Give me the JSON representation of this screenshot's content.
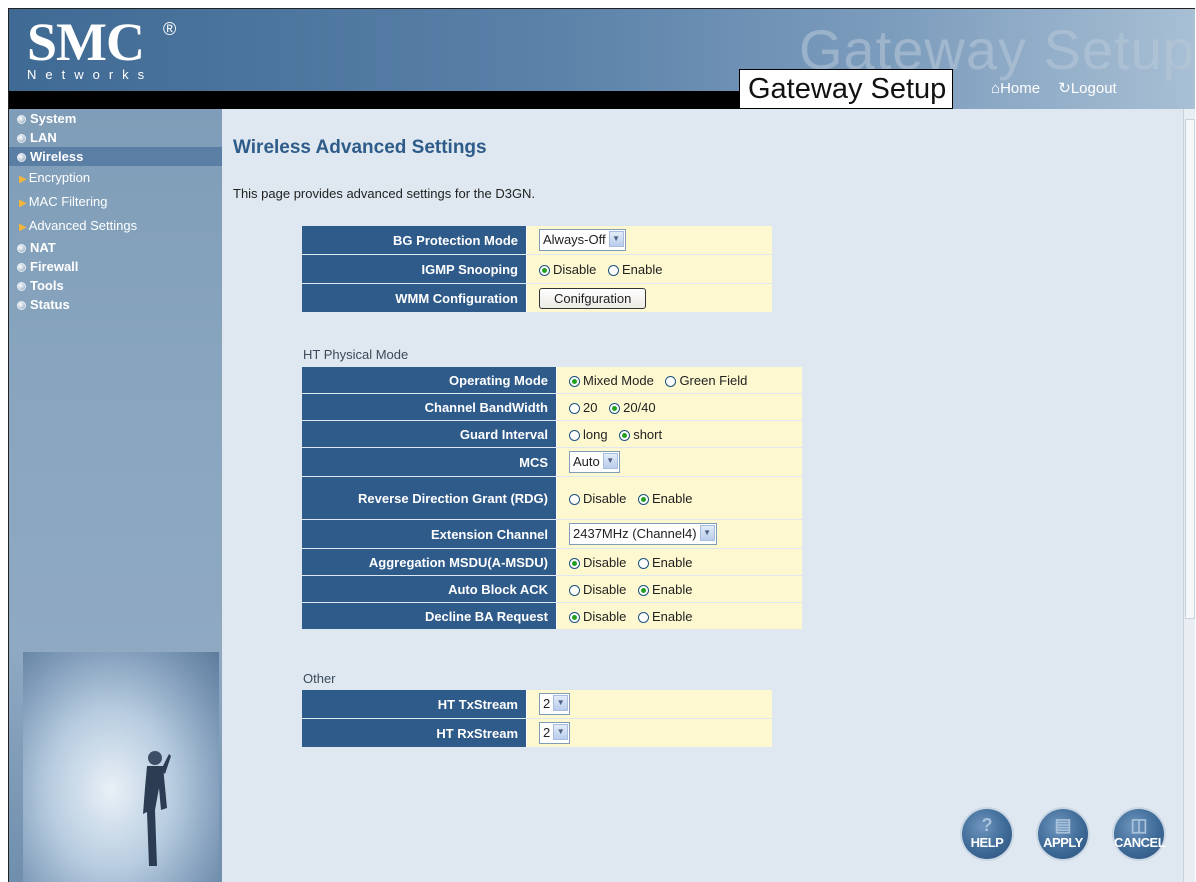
{
  "header": {
    "logo_main": "SMC",
    "logo_reg": "®",
    "logo_sub": "Networks",
    "banner_text": "Gateway Setup",
    "title": "Gateway Setup",
    "home_label": "Home",
    "logout_label": "Logout"
  },
  "sidebar": {
    "items": [
      {
        "label": "System"
      },
      {
        "label": "LAN"
      },
      {
        "label": "Wireless"
      },
      {
        "label": "NAT"
      },
      {
        "label": "Firewall"
      },
      {
        "label": "Tools"
      },
      {
        "label": "Status"
      }
    ],
    "sub_items": [
      {
        "label": "Encryption"
      },
      {
        "label": "MAC Filtering"
      },
      {
        "label": "Advanced Settings"
      }
    ]
  },
  "page": {
    "title": "Wireless Advanced Settings",
    "description": "This page provides advanced settings for the D3GN."
  },
  "basic": {
    "bg_protection": {
      "label": "BG Protection Mode",
      "value": "Always-Off"
    },
    "igmp": {
      "label": "IGMP Snooping",
      "opt1": "Disable",
      "opt2": "Enable",
      "selected": "Disable"
    },
    "wmm": {
      "label": "WMM Configuration",
      "button": "Conifguration"
    }
  },
  "ht": {
    "section_label": "HT Physical Mode",
    "operating_mode": {
      "label": "Operating Mode",
      "opt1": "Mixed Mode",
      "opt2": "Green Field",
      "selected": "Mixed Mode"
    },
    "bandwidth": {
      "label": "Channel BandWidth",
      "opt1": "20",
      "opt2": "20/40",
      "selected": "20/40"
    },
    "guard": {
      "label": "Guard Interval",
      "opt1": "long",
      "opt2": "short",
      "selected": "short"
    },
    "mcs": {
      "label": "MCS",
      "value": "Auto"
    },
    "rdg": {
      "label": "Reverse Direction Grant (RDG)",
      "opt1": "Disable",
      "opt2": "Enable",
      "selected": "Enable"
    },
    "ext_channel": {
      "label": "Extension Channel",
      "value": "2437MHz (Channel4)"
    },
    "amsdu": {
      "label": "Aggregation MSDU(A-MSDU)",
      "opt1": "Disable",
      "opt2": "Enable",
      "selected": "Disable"
    },
    "auto_ba": {
      "label": "Auto Block ACK",
      "opt1": "Disable",
      "opt2": "Enable",
      "selected": "Enable"
    },
    "decline_ba": {
      "label": "Decline BA Request",
      "opt1": "Disable",
      "opt2": "Enable",
      "selected": "Disable"
    }
  },
  "other": {
    "section_label": "Other",
    "tx": {
      "label": "HT TxStream",
      "value": "2"
    },
    "rx": {
      "label": "HT RxStream",
      "value": "2"
    }
  },
  "actions": {
    "help": "HELP",
    "apply": "APPLY",
    "cancel": "CANCEL"
  }
}
